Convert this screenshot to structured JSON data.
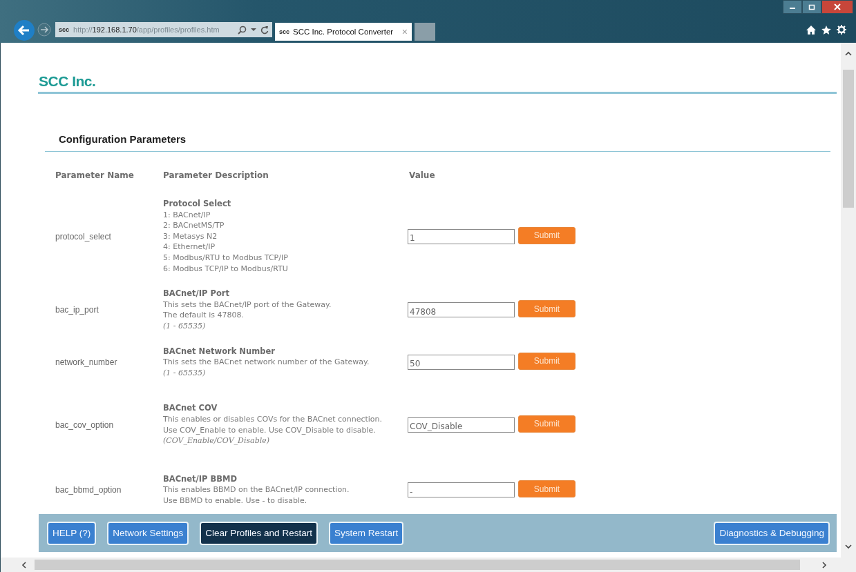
{
  "browser": {
    "site_badge": "scc",
    "url_scheme": "http://",
    "url_host": "192.168.1.70",
    "url_path": "/app/profiles/profiles.htm",
    "tab": {
      "badge": "scc",
      "title": "SCC Inc. Protocol Converter",
      "close": "×"
    }
  },
  "page": {
    "logo": "SCC Inc.",
    "section_title": "Configuration Parameters",
    "columns": [
      "Parameter Name",
      "Parameter Description",
      "Value"
    ],
    "rows": [
      {
        "name": "protocol_select",
        "title": "Protocol Select",
        "lines": [
          "1: BACnet/IP",
          "2: BACnetMS/TP",
          "3: Metasys N2",
          "4: Ethernet/IP",
          "5: Modbus/RTU to Modbus TCP/IP",
          "6: Modbus TCP/IP to Modbus/RTU"
        ],
        "value": "1",
        "submit": "Submit"
      },
      {
        "name": "bac_ip_port",
        "title": "BACnet/IP Port",
        "lines": [
          "This sets the BACnet/IP port of the Gateway.",
          "The default is 47808."
        ],
        "range": "(1 - 65535)",
        "value": "47808",
        "submit": "Submit"
      },
      {
        "name": "network_number",
        "title": "BACnet Network Number",
        "lines": [
          "This sets the BACnet network number of the Gateway."
        ],
        "range": "(1 - 65535)",
        "value": "50",
        "submit": "Submit"
      },
      {
        "name": "bac_cov_option",
        "title": "BACnet COV",
        "lines": [
          "This enables or disables COVs for the BACnet connection.",
          "Use COV_Enable to enable. Use COV_Disable to disable."
        ],
        "range": "(COV_Enable/COV_Disable)",
        "value": "COV_Disable",
        "submit": "Submit"
      },
      {
        "name": "bac_bbmd_option",
        "title": "BACnet/IP BBMD",
        "lines": [
          "This enables BBMD on the BACnet/IP connection.",
          "Use BBMD to enable. Use - to disable."
        ],
        "value": "-",
        "submit": "Submit"
      }
    ]
  },
  "bottom_bar": {
    "buttons": [
      {
        "label": "HELP (?)",
        "selected": false
      },
      {
        "label": "Network Settings",
        "selected": false
      },
      {
        "label": "Clear Profiles and Restart",
        "selected": true
      },
      {
        "label": "System Restart",
        "selected": false
      }
    ],
    "right_buttons": [
      {
        "label": "Diagnostics & Debugging",
        "selected": false
      }
    ]
  }
}
